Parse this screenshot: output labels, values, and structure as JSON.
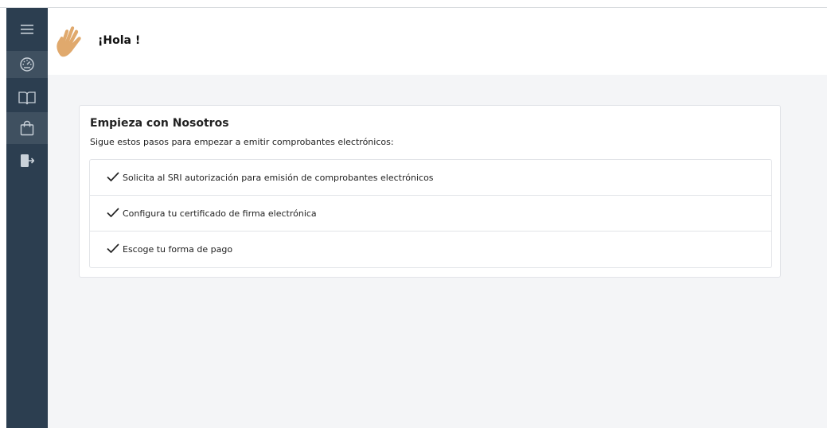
{
  "header": {
    "greeting": "¡Hola !"
  },
  "sidebar": {
    "items": [
      {
        "icon": "menu-icon"
      },
      {
        "icon": "dashboard-icon"
      },
      {
        "icon": "book-icon"
      },
      {
        "icon": "shopping-bag-icon"
      },
      {
        "icon": "logout-icon"
      }
    ]
  },
  "card": {
    "title": "Empieza con Nosotros",
    "subtitle": "Sigue estos pasos para empezar a emitir comprobantes electrónicos:",
    "steps": [
      {
        "label": "Solicita al SRI autorización para emisión de comprobantes electrónicos"
      },
      {
        "label": "Configura tu certificado de firma electrónica"
      },
      {
        "label": "Escoge tu forma de pago"
      }
    ]
  },
  "colors": {
    "sidebar_bg": "#2c3e50",
    "sidebar_active": "#3f5060",
    "content_bg": "#f4f5f7",
    "hand": "#e0a96d"
  }
}
